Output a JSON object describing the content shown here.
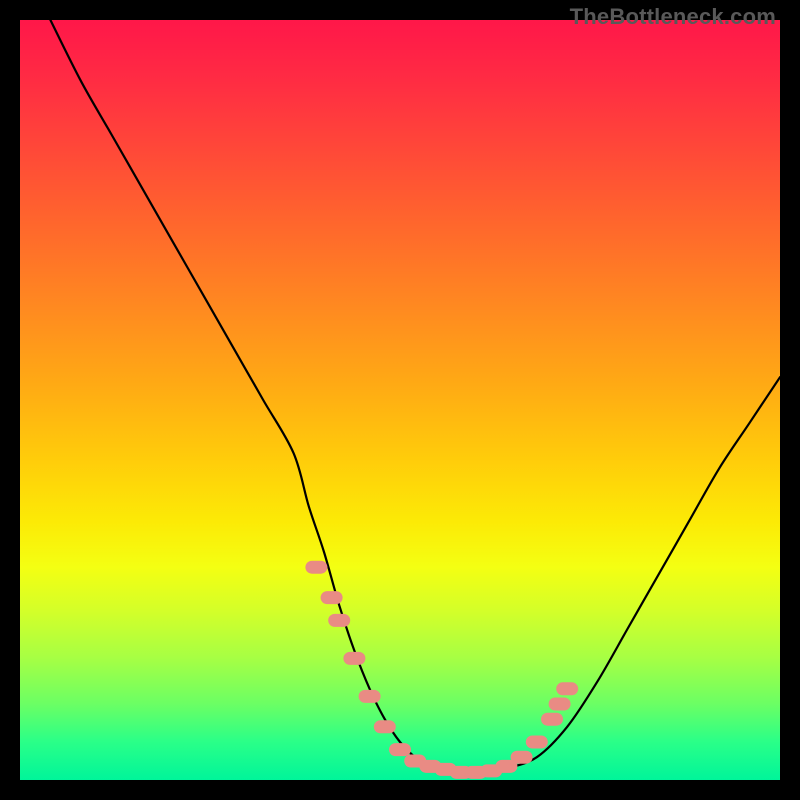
{
  "watermark": "TheBottleneck.com",
  "colors": {
    "frame": "#000000",
    "marker": "#e98b84",
    "curve": "#000000"
  },
  "chart_data": {
    "type": "line",
    "title": "",
    "xlabel": "",
    "ylabel": "",
    "xlim": [
      0,
      100
    ],
    "ylim": [
      0,
      100
    ],
    "grid": false,
    "legend": false,
    "series": [
      {
        "name": "bottleneck-curve",
        "x": [
          4,
          8,
          12,
          16,
          20,
          24,
          28,
          32,
          36,
          38,
          40,
          42,
          44,
          46,
          48,
          50,
          52,
          54,
          56,
          58,
          60,
          62,
          64,
          68,
          72,
          76,
          80,
          84,
          88,
          92,
          96,
          100
        ],
        "y": [
          100,
          92,
          85,
          78,
          71,
          64,
          57,
          50,
          43,
          36,
          30,
          23,
          17,
          12,
          8,
          5,
          3,
          2,
          1.5,
          1,
          1,
          1,
          1.5,
          3,
          7,
          13,
          20,
          27,
          34,
          41,
          47,
          53
        ]
      }
    ],
    "markers": {
      "name": "highlight-points",
      "x": [
        39,
        41,
        42,
        44,
        46,
        48,
        50,
        52,
        54,
        56,
        58,
        60,
        62,
        64,
        66,
        68,
        70,
        71,
        72
      ],
      "y": [
        28,
        24,
        21,
        16,
        11,
        7,
        4,
        2.5,
        1.8,
        1.4,
        1,
        1,
        1.2,
        1.8,
        3,
        5,
        8,
        10,
        12
      ]
    }
  }
}
